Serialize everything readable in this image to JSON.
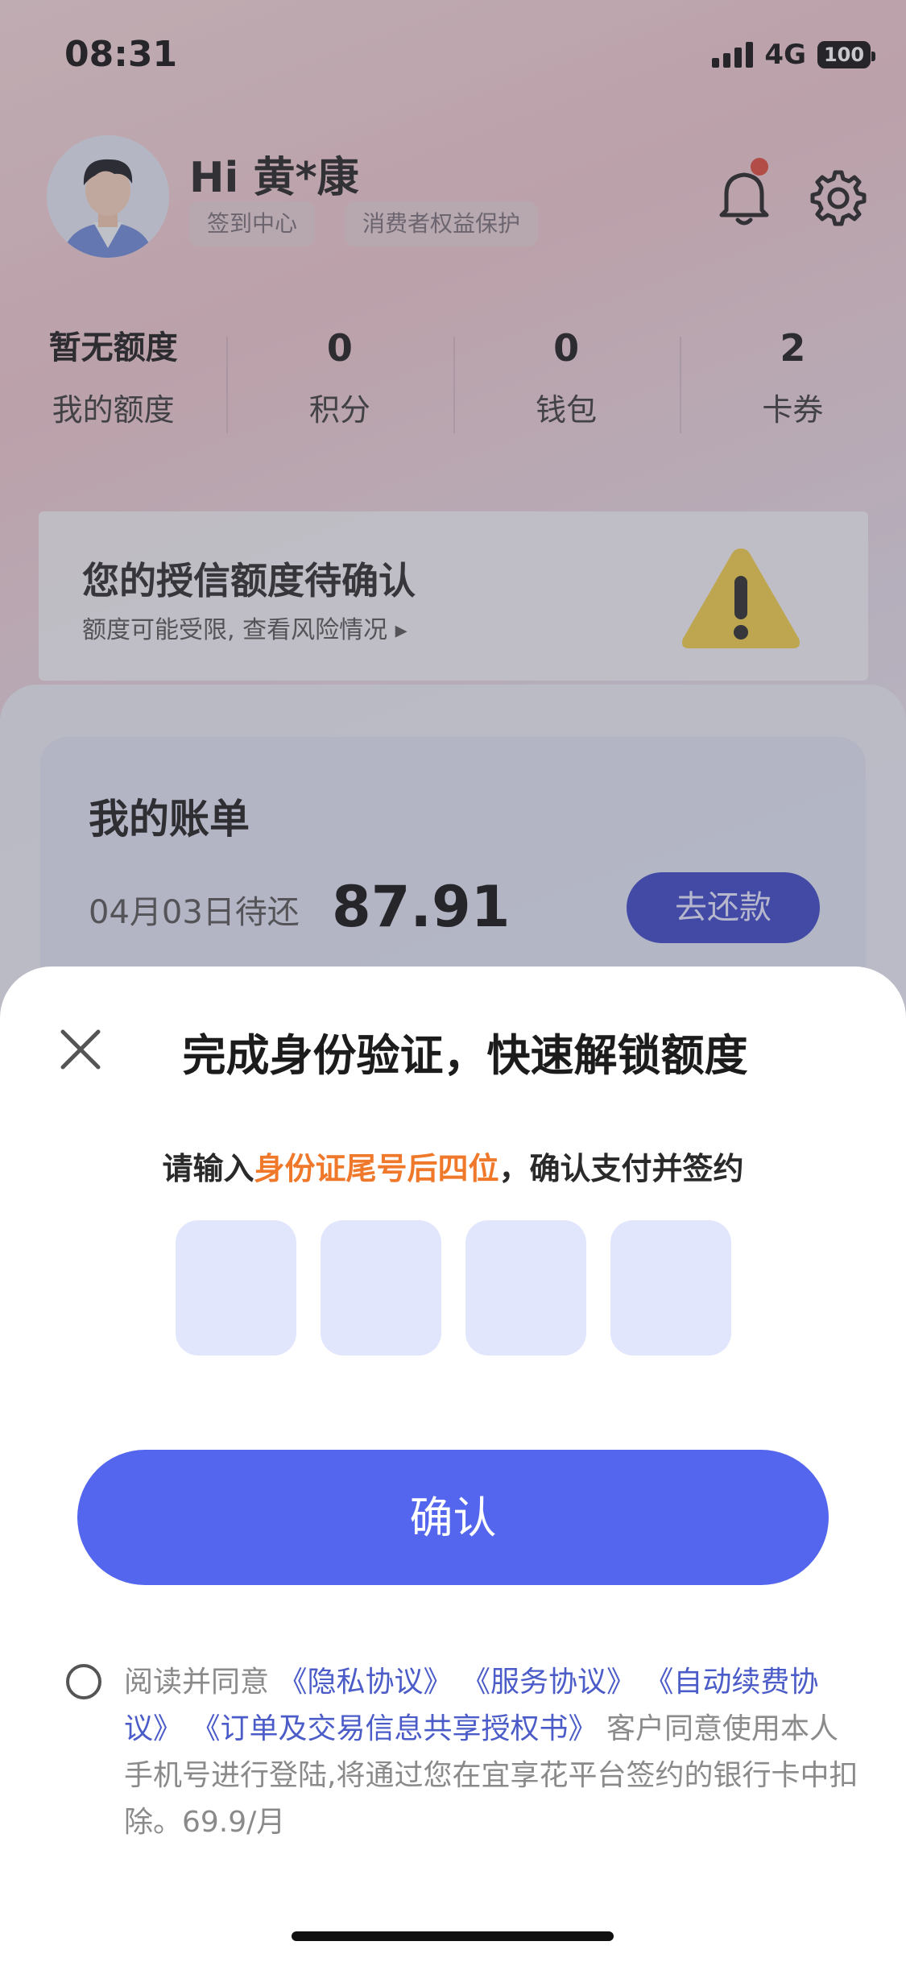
{
  "status_bar": {
    "time": "08:31",
    "network": "4G",
    "battery": "100"
  },
  "header": {
    "greeting": "Hi 黄*康",
    "tags": [
      "签到中心",
      "消费者权益保护"
    ]
  },
  "stats": [
    {
      "value": "暂无额度",
      "label": "我的额度"
    },
    {
      "value": "0",
      "label": "积分"
    },
    {
      "value": "0",
      "label": "钱包"
    },
    {
      "value": "2",
      "label": "卡券"
    }
  ],
  "warning_card": {
    "title": "您的授信额度待确认",
    "subtitle": "额度可能受限, 查看风险情况 ▸"
  },
  "bill": {
    "title": "我的账单",
    "due_date": "04月03日待还",
    "amount": "87.91",
    "repay_label": "去还款"
  },
  "modal": {
    "title": "完成身份验证，快速解锁额度",
    "prompt_before": "请输入",
    "prompt_highlight": "身份证尾号后四位",
    "prompt_after": "，确认支付并签约",
    "code_length": 4,
    "confirm_label": "确认",
    "agreement": {
      "prefix": "阅读并同意",
      "links": [
        "《隐私协议》",
        "《服务协议》",
        "《自动续费协议》",
        "《订单及交易信息共享授权书》"
      ],
      "suffix": "客户同意使用本人手机号进行登陆,将通过您在宜享花平台签约的银行卡中扣除。69.9/月"
    }
  },
  "colors": {
    "primary": "#5465ee",
    "highlight": "#f0782a",
    "link": "#4b5cc8",
    "repay_button": "#3b47c7"
  },
  "icons": [
    "bell-icon",
    "gear-icon",
    "warning-icon",
    "close-icon"
  ]
}
